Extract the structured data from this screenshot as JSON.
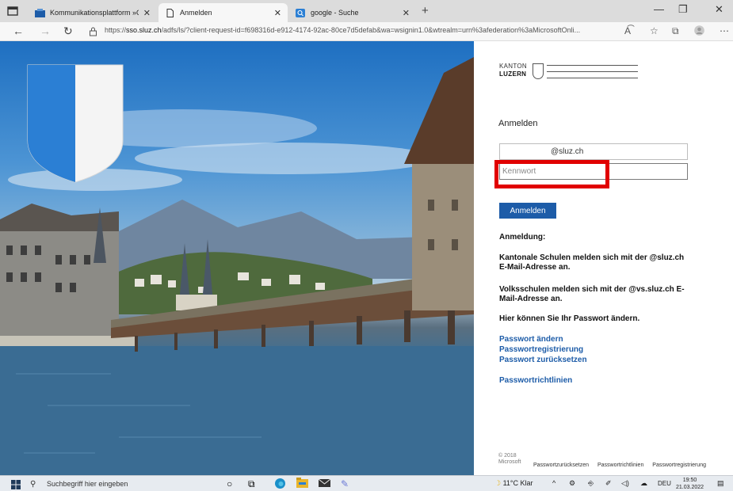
{
  "browser": {
    "tabs": [
      {
        "label": "Kommunikationsplattform »Offic",
        "favicon": "office-icon"
      },
      {
        "label": "Anmelden",
        "favicon": "page-icon"
      },
      {
        "label": "google - Suche",
        "favicon": "search-icon"
      }
    ],
    "new_tab": "+",
    "url_prefix": "https://",
    "url_host": "sso.sluz.ch",
    "url_rest": "/adfs/ls/?client-request-id=f698316d-e912-4174-92ac-80ce7d5defab&wa=wsignin1.0&wtrealm=urn%3afederation%3aMicrosoftOnli..."
  },
  "login": {
    "logo_top": "KANTON",
    "logo_bottom": "LUZERN",
    "title": "Anmelden",
    "email_value": "@sluz.ch",
    "password_placeholder": "Kennwort",
    "submit_label": "Anmelden",
    "info": {
      "heading": "Anmeldung:",
      "line1": "Kantonale Schulen melden sich mit der @sluz.ch E-Mail-Adresse an.",
      "line2": "Volksschulen melden sich mit der @vs.sluz.ch E-Mail-Adresse an.",
      "line3": "Hier können Sie Ihr Passwort ändern."
    },
    "links": [
      "Passwort ändern",
      "Passwortregistrierung",
      "Passwort zurücksetzen"
    ],
    "policy_link": "Passwortrichtlinien",
    "footer": {
      "year": "© 2018",
      "company": "Microsoft",
      "links": [
        "Passwortzurücksetzen",
        "Passwortrichtlinien",
        "Passwortregistrierung"
      ]
    }
  },
  "taskbar": {
    "search_placeholder": "Suchbegriff hier eingeben",
    "weather": "11°C  Klar",
    "lang": "DEU",
    "time": "19:50",
    "date": "21.03.2022"
  },
  "colors": {
    "accent": "#1d5ca8",
    "highlight": "#e10000",
    "shield_blue": "#2b7fd4"
  }
}
